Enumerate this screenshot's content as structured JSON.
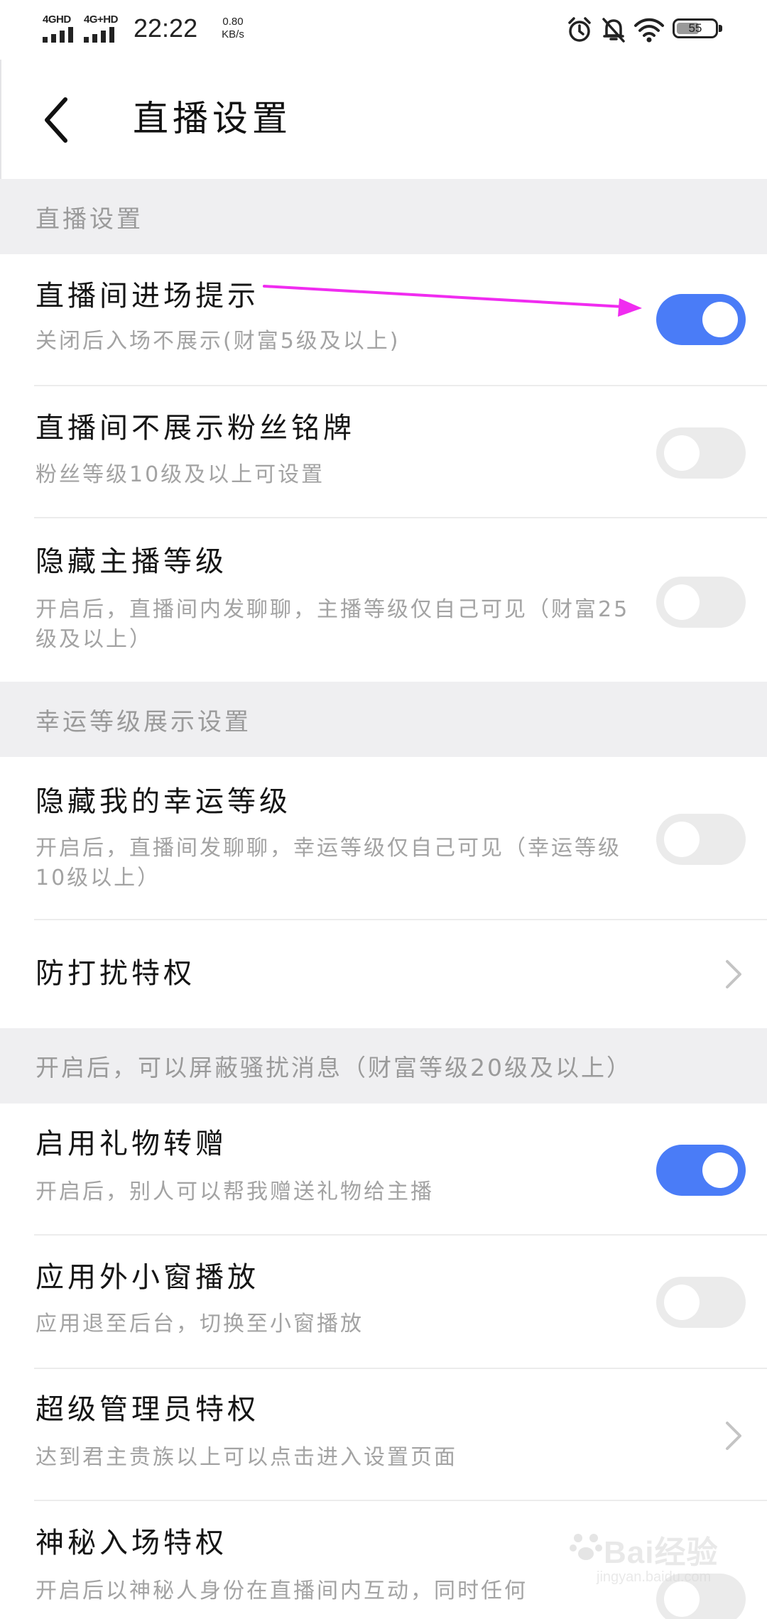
{
  "status_bar": {
    "network1": "4GHD",
    "network2": "4G+HD",
    "time": "22:22",
    "speed_value": "0.80",
    "speed_unit": "KB/s",
    "battery": "55",
    "icons": [
      "alarm-icon",
      "mute-bell-icon",
      "wifi-icon",
      "battery-icon"
    ]
  },
  "header": {
    "title": "直播设置",
    "back_icon": "back-chevron-icon"
  },
  "sections": {
    "live_settings": "直播设置",
    "lucky_level": "幸运等级展示设置",
    "anti_disturb_note": "开启后，可以屏蔽骚扰消息（财富等级20级及以上）"
  },
  "rows": {
    "entry_prompt": {
      "title": "直播间进场提示",
      "sub": "关闭后入场不展示(财富5级及以上)",
      "enabled": true
    },
    "hide_fan_badge": {
      "title": "直播间不展示粉丝铭牌",
      "sub": "粉丝等级10级及以上可设置",
      "enabled": false
    },
    "hide_anchor_level": {
      "title": "隐藏主播等级",
      "sub": "开启后，直播间内发聊聊，主播等级仅自己可见（财富25级及以上）",
      "enabled": false
    },
    "hide_lucky_level": {
      "title": "隐藏我的幸运等级",
      "sub": "开启后，直播间发聊聊，幸运等级仅自己可见（幸运等级10级以上）",
      "enabled": false
    },
    "anti_disturb": {
      "title": "防打扰特权"
    },
    "gift_transfer": {
      "title": "启用礼物转赠",
      "sub": "开启后，别人可以帮我赠送礼物给主播",
      "enabled": true
    },
    "mini_window": {
      "title": "应用外小窗播放",
      "sub": "应用退至后台，切换至小窗播放",
      "enabled": false
    },
    "super_admin": {
      "title": "超级管理员特权",
      "sub": "达到君主贵族以上可以点击进入设置页面"
    },
    "mystery_entry": {
      "title": "神秘入场特权",
      "sub": "开启后以神秘人身份在直播间内互动，同时任何"
    }
  },
  "watermark": {
    "text": "Bai经验",
    "url": "jingyan.baidu.com"
  },
  "colors": {
    "toggle_on": "#4a7cf7",
    "toggle_off": "#ebebeb",
    "section_bg": "#efeff1",
    "annotation_arrow": "#f02cf0"
  }
}
